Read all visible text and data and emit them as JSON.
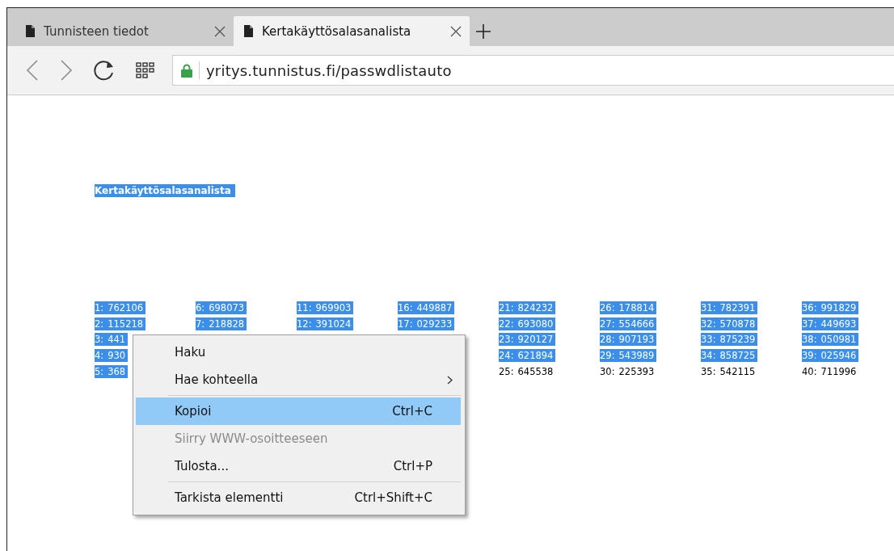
{
  "tabs": [
    {
      "title": "Tunnisteen tiedot",
      "selected": false
    },
    {
      "title": "Kertakäyttösalasanalista",
      "selected": true
    }
  ],
  "address_bar": {
    "url": "yritys.tunnistus.fi/passwdlistauto",
    "secure": true
  },
  "page": {
    "heading": {
      "text": "Kertakäyttösalasanalista",
      "selected": true
    },
    "columns": [
      {
        "entries": [
          {
            "number": "1:",
            "code": "762106",
            "selected": true
          },
          {
            "number": "2:",
            "code": "115218",
            "selected": true
          },
          {
            "number": "3:",
            "code": "441",
            "selected": true
          },
          {
            "number": "4:",
            "code": "930",
            "selected": true
          },
          {
            "number": "5:",
            "code": "368",
            "selected": true
          }
        ]
      },
      {
        "entries": [
          {
            "number": "6:",
            "code": "698073",
            "selected": true
          },
          {
            "number": "7:",
            "code": "218828",
            "selected": true
          }
        ]
      },
      {
        "entries": [
          {
            "number": "11:",
            "code": "969903",
            "selected": true
          },
          {
            "number": "12:",
            "code": "391024",
            "selected": true
          }
        ]
      },
      {
        "entries": [
          {
            "number": "16:",
            "code": "449887",
            "selected": true
          },
          {
            "number": "17:",
            "code": "029233",
            "selected": true
          }
        ]
      },
      {
        "entries": [
          {
            "number": "21:",
            "code": "824232",
            "selected": true
          },
          {
            "number": "22:",
            "code": "693080",
            "selected": true
          },
          {
            "number": "23:",
            "code": "920127",
            "selected": true
          },
          {
            "number": "24:",
            "code": "621894",
            "selected": true
          },
          {
            "number": "25:",
            "code": "645538",
            "selected": false
          }
        ]
      },
      {
        "entries": [
          {
            "number": "26:",
            "code": "178814",
            "selected": true
          },
          {
            "number": "27:",
            "code": "554666",
            "selected": true
          },
          {
            "number": "28:",
            "code": "907193",
            "selected": true
          },
          {
            "number": "29:",
            "code": "543989",
            "selected": true
          },
          {
            "number": "30:",
            "code": "225393",
            "selected": false
          }
        ]
      },
      {
        "entries": [
          {
            "number": "31:",
            "code": "782391",
            "selected": true
          },
          {
            "number": "32:",
            "code": "570878",
            "selected": true
          },
          {
            "number": "33:",
            "code": "875239",
            "selected": true
          },
          {
            "number": "34:",
            "code": "858725",
            "selected": true
          },
          {
            "number": "35:",
            "code": "542115",
            "selected": false
          }
        ]
      },
      {
        "entries": [
          {
            "number": "36:",
            "code": "991829",
            "selected": true
          },
          {
            "number": "37:",
            "code": "449693",
            "selected": true
          },
          {
            "number": "38:",
            "code": "050981",
            "selected": true
          },
          {
            "number": "39:",
            "code": "025946",
            "selected": true
          },
          {
            "number": "40:",
            "code": "711996",
            "selected": false
          }
        ]
      }
    ]
  },
  "context_menu": {
    "items": [
      {
        "kind": "item",
        "label": "Haku",
        "disabled": false,
        "selected": false,
        "submenu": false
      },
      {
        "kind": "item",
        "label": "Hae kohteella",
        "disabled": false,
        "selected": false,
        "submenu": true
      },
      {
        "kind": "separator"
      },
      {
        "kind": "item",
        "label": "Kopioi",
        "shortcut": "Ctrl+C",
        "disabled": false,
        "selected": true,
        "submenu": false
      },
      {
        "kind": "item",
        "label": "Siirry WWW-osoitteeseen",
        "disabled": true,
        "selected": false,
        "submenu": false
      },
      {
        "kind": "item",
        "label": "Tulosta...",
        "shortcut": "Ctrl+P",
        "disabled": false,
        "selected": false,
        "submenu": false
      },
      {
        "kind": "separator"
      },
      {
        "kind": "item",
        "label": "Tarkista elementti",
        "shortcut": "Ctrl+Shift+C",
        "disabled": false,
        "selected": false,
        "submenu": false
      }
    ]
  }
}
